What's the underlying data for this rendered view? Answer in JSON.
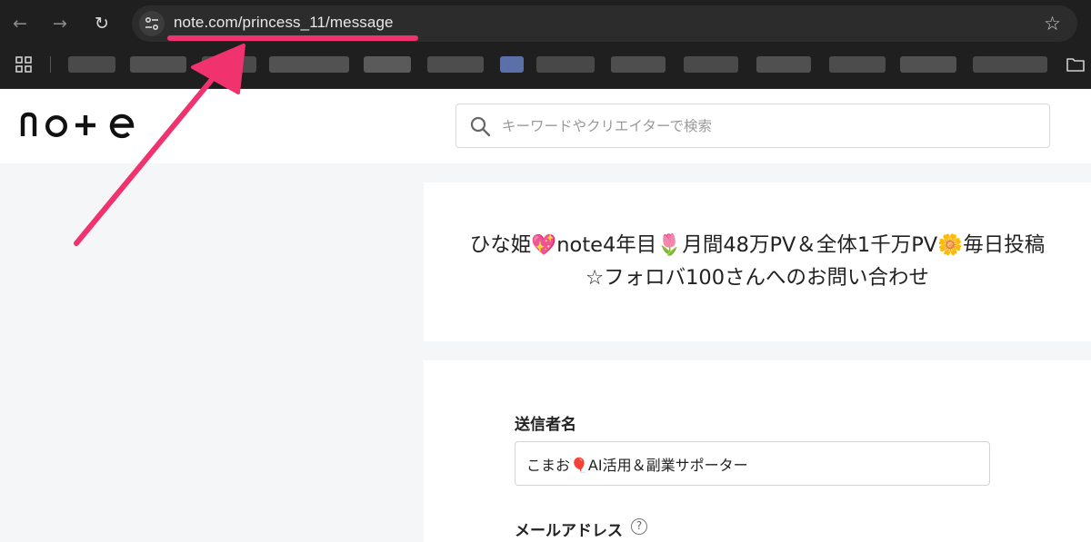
{
  "browser": {
    "url": "note.com/princess_11/message",
    "back_icon": "←",
    "forward_icon": "→",
    "reload_icon": "↻",
    "star_icon": "☆",
    "colors": {
      "toolbar": "#1f1f1f",
      "annotation": "#f0336f"
    }
  },
  "header": {
    "logo_text": "note",
    "search_placeholder": "キーワードやクリエイターで検索"
  },
  "title_card": {
    "line1": "ひな姫💖note4年目🌷月間48万PV＆全体1千万PV🌼毎日投稿",
    "line2": "☆フォロバ100さんへのお問い合わせ"
  },
  "form": {
    "sender_label": "送信者名",
    "sender_value": "こまお🎈AI活用＆副業サポーター",
    "email_label": "メールアドレス",
    "help_glyph": "?"
  }
}
